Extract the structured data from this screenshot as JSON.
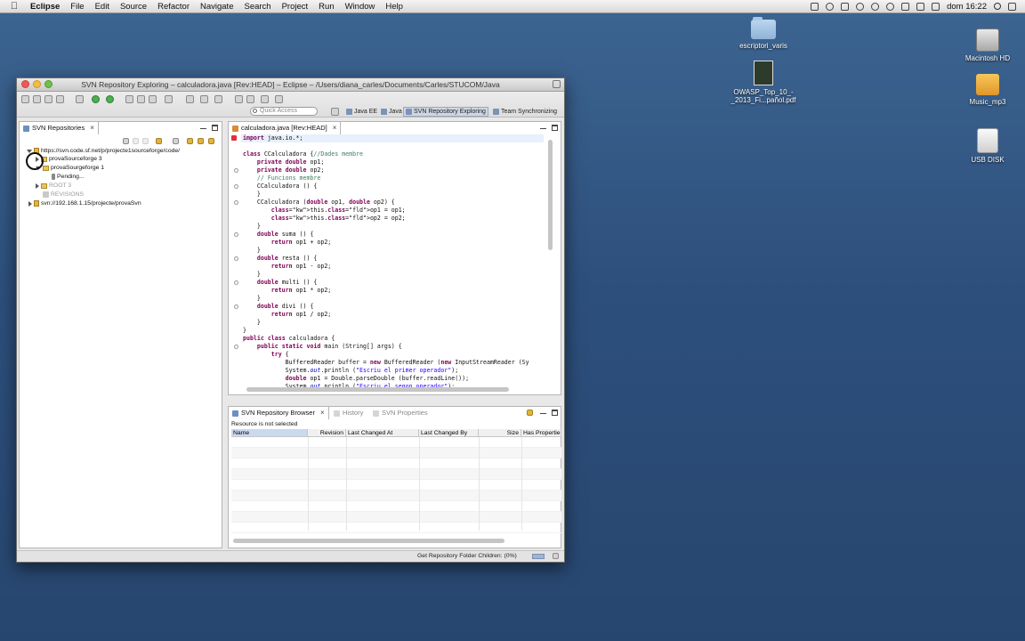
{
  "menubar": {
    "app": "Eclipse",
    "items": [
      "File",
      "Edit",
      "Source",
      "Refactor",
      "Navigate",
      "Search",
      "Project",
      "Run",
      "Window",
      "Help"
    ],
    "clock": "dom 16:22"
  },
  "desktop": {
    "icons": [
      {
        "label": "escriptori_varis",
        "kind": "folder"
      },
      {
        "label": "OWASP_Top_10_-_2013_Fi...pañol.pdf",
        "kind": "pdf"
      },
      {
        "label": "Macintosh HD",
        "kind": "hd"
      },
      {
        "label": "Music_mp3",
        "kind": "usb-folder"
      },
      {
        "label": "USB DISK",
        "kind": "usb"
      }
    ]
  },
  "window": {
    "title": "SVN Repository Exploring – calculadora.java [Rev:HEAD] – Eclipse – /Users/diana_carles/Documents/Carles/STUCOM/Java"
  },
  "toolbar": {
    "quick_access_placeholder": "Quick Access",
    "perspectives": [
      {
        "label": "Java EE",
        "active": false
      },
      {
        "label": "Java",
        "active": false
      },
      {
        "label": "SVN Repository Exploring",
        "active": true
      },
      {
        "label": "Team Synchronizing",
        "active": false
      }
    ]
  },
  "svn_repositories": {
    "tab": "SVN Repositories",
    "tree": [
      {
        "label": "https://svn.code.sf.net/p/projecte1sourceforge/code/",
        "level": 0,
        "expanded": true
      },
      {
        "label": "provaSourceforge 3",
        "level": 1,
        "expanded": false
      },
      {
        "label": "provaSourgeforge 1",
        "level": 1,
        "expanded": true
      },
      {
        "label": "Pending...",
        "level": 2
      },
      {
        "label": "ROOT 3",
        "level": 1,
        "expanded": false,
        "muted": true
      },
      {
        "label": "REVISIONS",
        "level": 1,
        "muted": true
      },
      {
        "label": "svn://192.168.1.15/projecte/provaSvn",
        "level": 0,
        "expanded": false
      }
    ]
  },
  "editor": {
    "tab": "calculadora.java [Rev:HEAD]",
    "lines": [
      "import java.io.*;",
      "",
      "class CCalculadora {//Dades membre",
      "    private double op1;",
      "    private double op2;",
      "    // Funcions membre",
      "    CCalculadora () {",
      "    }",
      "    CCalculadora (double op1, double op2) {",
      "        this.op1 = op1;",
      "        this.op2 = op2;",
      "    }",
      "    double suma () {",
      "        return op1 + op2;",
      "    }",
      "    double resta () {",
      "        return op1 - op2;",
      "    }",
      "    double multi () {",
      "        return op1 * op2;",
      "    }",
      "    double divi () {",
      "        return op1 / op2;",
      "    }",
      "}",
      "public class calculadora {",
      "    public static void main (String[] args) {",
      "        try {",
      "            BufferedReader buffer = new BufferedReader (new InputStreamReader (Sy",
      "            System.out.println (\"Escriu el primer operador\");",
      "            double op1 = Double.parseDouble (buffer.readLine());",
      "            System.out.println (\"Escriu el segon operador\");"
    ]
  },
  "browser": {
    "tabs": [
      "SVN Repository Browser",
      "History",
      "SVN Properties"
    ],
    "status": "Resource is not selected",
    "columns": [
      "Name",
      "Revision",
      "Last Changed At",
      "Last Changed By",
      "Size",
      "Has Propertie"
    ]
  },
  "statusbar": {
    "text": "Get Repository Folder Children: (0%)"
  },
  "colors": {
    "keyword": "#7f0055",
    "field": "#0000c0",
    "comment": "#3f7f5f",
    "string": "#2a00ff"
  }
}
